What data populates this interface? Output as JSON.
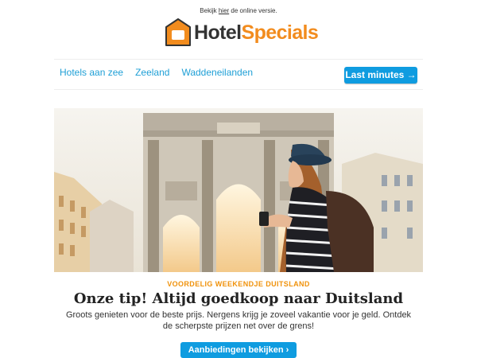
{
  "preheader": {
    "before": "Bekijk ",
    "link": "hier",
    "after": " de online versie."
  },
  "logo": {
    "hotel": "Hotel",
    "specials": "Specials",
    "brand_color": "#f28c1e",
    "icon": "house-icon"
  },
  "nav": {
    "items": [
      "Hotels aan zee",
      "Zeeland",
      "Waddeneilanden"
    ],
    "cta": "Last minutes →"
  },
  "hero": {
    "image": "woman-with-hat-at-munich-siegestor"
  },
  "article": {
    "eyebrow": "VOORDELIG WEEKENDJE DUITSLAND",
    "headline": "Onze tip! Altijd goedkoop naar Duitsland",
    "body": "Groots genieten voor de beste prijs. Nergens krijg je zoveel vakantie voor je geld. Ontdek de scherpste prijzen net over de grens!",
    "cta": "Aanbiedingen bekijken ›"
  },
  "colors": {
    "accent_blue": "#0f9ce0",
    "link_blue": "#1e9fd6",
    "eyebrow_orange": "#f0920b"
  }
}
